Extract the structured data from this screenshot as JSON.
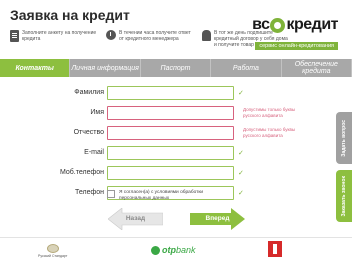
{
  "header": {
    "title": "Заявка на кредит",
    "steps": [
      {
        "icon": "document-icon",
        "text": "Заполните анкету на получение кредита"
      },
      {
        "icon": "clock-icon",
        "text": "В течении часа получите ответ от кредитного менеджера"
      },
      {
        "icon": "person-icon",
        "text": "В тот же день подпишите кредитный договор у себя дома и получите товар"
      }
    ],
    "logo": {
      "left": "вс",
      "right": "кредит",
      "tagline": "сервис онлайн-кредитования"
    }
  },
  "tabs": [
    {
      "label": "Контакты",
      "active": true
    },
    {
      "label": "Личная информация",
      "active": false
    },
    {
      "label": "Паспорт",
      "active": false
    },
    {
      "label": "Работа",
      "active": false
    },
    {
      "label": "Обеспечение кредита",
      "active": false
    }
  ],
  "form": {
    "fields": [
      {
        "label": "Фамилия",
        "value": "",
        "state": "ok",
        "check": "✓",
        "hint": ""
      },
      {
        "label": "Имя",
        "value": "",
        "state": "error",
        "check": "",
        "hint": "Допустимы только буквы русского алфавита"
      },
      {
        "label": "Отчество",
        "value": "",
        "state": "error",
        "check": "",
        "hint": "Допустимы только буквы русского алфавита"
      },
      {
        "label": "E-mail",
        "value": "",
        "state": "ok",
        "check": "✓",
        "hint": ""
      },
      {
        "label": "Моб.телефон",
        "value": "",
        "state": "ok",
        "check": "✓",
        "hint": ""
      },
      {
        "label": "Телефон",
        "value": "",
        "state": "ok",
        "check": "✓",
        "hint": ""
      }
    ],
    "consent": "Я согласен(а) с условиями обработки персональных данных",
    "back_label": "Назад",
    "next_label": "Вперед"
  },
  "side": {
    "tab1": "Задать вопрос",
    "tab2": "Заказать звонок"
  },
  "footer": {
    "partner1_caption": "Русский Стандарт",
    "partner2_prefix": "otp",
    "partner2_suffix": "bank"
  },
  "colors": {
    "accent": "#8dbf3f",
    "error": "#d7627e",
    "tabs_bg": "#a8a8a8"
  }
}
